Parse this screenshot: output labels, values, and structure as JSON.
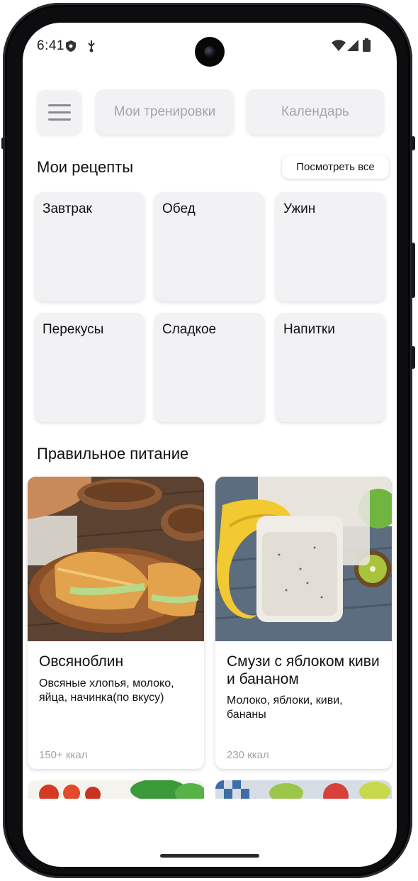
{
  "status_bar": {
    "time": "6:41",
    "icons": [
      "shield-icon",
      "usb-debug-icon",
      "wifi-icon",
      "cellular-signal-icon",
      "battery-icon"
    ]
  },
  "top_bar": {
    "menu_icon": "hamburger-menu-icon",
    "workouts_label": "Мои тренировки",
    "calendar_label": "Календарь"
  },
  "my_recipes": {
    "title": "Мои рецепты",
    "see_all_label": "Посмотреть все",
    "categories": [
      {
        "label": "Завтрак"
      },
      {
        "label": "Обед"
      },
      {
        "label": "Ужин"
      },
      {
        "label": "Перекусы"
      },
      {
        "label": "Сладкое"
      },
      {
        "label": "Напитки"
      }
    ]
  },
  "healthy_eating": {
    "title": "Правильное питание",
    "cards": [
      {
        "name": "Овсяноблин",
        "description": "Овсяные хлопья, молоко, яйца, начинка(по вкусу)",
        "calories": "150+ ккал"
      },
      {
        "name": "Смузи с яблоком киви и бананом",
        "description": "Молоко, яблоки, киви, бананы",
        "calories": "230 ккал"
      }
    ]
  },
  "colors": {
    "tile_background": "#f2f1f4",
    "muted_text": "#a6a5ab",
    "text": "#111111"
  }
}
